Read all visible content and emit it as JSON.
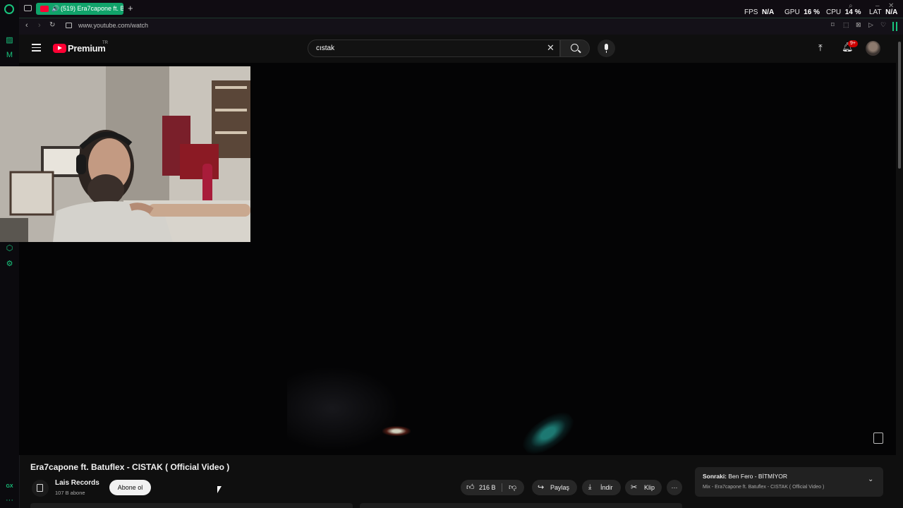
{
  "browser": {
    "tab_title": "(519) Era7capone ft. B",
    "url": "www.youtube.com/watch",
    "stats": {
      "fps_label": "FPS",
      "fps_value": "N/A",
      "gpu_label": "GPU",
      "gpu_value": "16 %",
      "cpu_label": "CPU",
      "cpu_value": "14 %",
      "lat_label": "LAT",
      "lat_value": "N/A"
    },
    "rail_bottom_label": "GX"
  },
  "youtube": {
    "logo_text": "Premium",
    "logo_region": "TR",
    "search_value": "cıstak",
    "notification_badge": "9+"
  },
  "video": {
    "title": "Era7capone ft. Batuflex - CISTAK ( Official Video )",
    "channel_name": "Lais Records",
    "subscribers": "107 B abone",
    "subscribe_label": "Abone ol",
    "like_count": "216 B",
    "share_label": "Paylaş",
    "download_label": "İndir",
    "clip_label": "Klip",
    "more_label": "···"
  },
  "next_up": {
    "prefix": "Sonraki:",
    "title": "Ben Fero - BİTMİYOR",
    "subtitle": "Mix - Era7capone ft. Batuflex - CISTAK ( Official Video )"
  },
  "colors": {
    "accent_green": "#19c37d",
    "tab_active": "#10a36a",
    "youtube_red": "#ff0033",
    "background": "#0f0f0f"
  }
}
